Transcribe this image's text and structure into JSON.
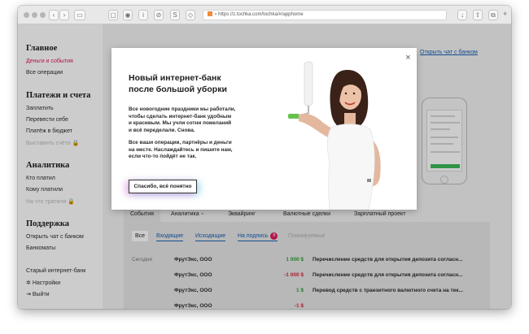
{
  "browser": {
    "url": "https://z.tochka.com/tochka/#/apphome",
    "tab_glyphs": {
      "info": "i",
      "share": "S",
      "stop": "☐",
      "plus": "+"
    }
  },
  "sidebar": {
    "sections": [
      {
        "title": "Главное",
        "items": [
          {
            "label": "Деньги и события",
            "state": "active"
          },
          {
            "label": "Все операции",
            "state": "normal"
          }
        ]
      },
      {
        "title": "Платежи и счета",
        "items": [
          {
            "label": "Заплатить",
            "state": "normal"
          },
          {
            "label": "Перевести себе",
            "state": "normal"
          },
          {
            "label": "Платёж в бюджет",
            "state": "normal"
          },
          {
            "label": "Выставить счёта",
            "state": "disabled"
          }
        ]
      },
      {
        "title": "Аналитика",
        "items": [
          {
            "label": "Кто платил",
            "state": "normal"
          },
          {
            "label": "Кому платили",
            "state": "normal"
          },
          {
            "label": "На что тратили",
            "state": "disabled"
          }
        ]
      },
      {
        "title": "Поддержка",
        "items": [
          {
            "label": "Открыть чат с банком",
            "state": "normal"
          },
          {
            "label": "Банкоматы",
            "state": "normal"
          }
        ]
      }
    ],
    "bottom": {
      "old_bank": "Старый интернет-банк",
      "settings": "Настройки",
      "logout": "Выйти"
    }
  },
  "main": {
    "chat_link": "Открыть чат с банком",
    "tabs": [
      "События",
      "Аналитика",
      "Эквайринг",
      "Валютные сделки",
      "Зарплатный проект"
    ],
    "filters": {
      "all": "Все",
      "incoming": "Входящие",
      "outgoing": "Исходящие",
      "to_sign": "На подпись",
      "to_sign_count": "8",
      "planned": "Планируемые"
    },
    "rows": [
      {
        "date": "Сегодня",
        "party": "ФрутЭкс, ООО",
        "amount": "1 000 $",
        "sign": "pos",
        "desc": "Перечисление средств для открытия депозита согласн..."
      },
      {
        "date": "",
        "party": "ФрутЭкс, ООО",
        "amount": "-1 000 $",
        "sign": "neg",
        "desc": "Перечисление средств для открытия депозита согласн..."
      },
      {
        "date": "",
        "party": "ФрутЭкс, ООО",
        "amount": "1 $",
        "sign": "pos",
        "desc": "Перевод средств с транзитного валютного счета на тек..."
      },
      {
        "date": "",
        "party": "ФрутЭкс, ООО",
        "amount": "-1 $",
        "sign": "neg",
        "desc": ""
      }
    ]
  },
  "modal": {
    "title_lines": [
      "Новый интернет-банк",
      "после большой уборки"
    ],
    "para1_lines": [
      "Все новогодние праздники мы работали,",
      "чтобы сделать интернет-банк удобным",
      "и красивым. Мы учли сотни пожеланий",
      "и всё переделали. Снова."
    ],
    "para2_lines": [
      "Все ваши операции, партнёры и деньги",
      "на месте. Наслаждайтесь и пишите нам,",
      "если что-то пойдёт не так."
    ],
    "button": "Спасибо, всё понятно",
    "close": "×"
  },
  "colors": {
    "accent": "#e0195a",
    "link": "#1a5fb4",
    "positive": "#2f9a37",
    "negative": "#d2263a",
    "cta_glow": "#d278d2"
  }
}
